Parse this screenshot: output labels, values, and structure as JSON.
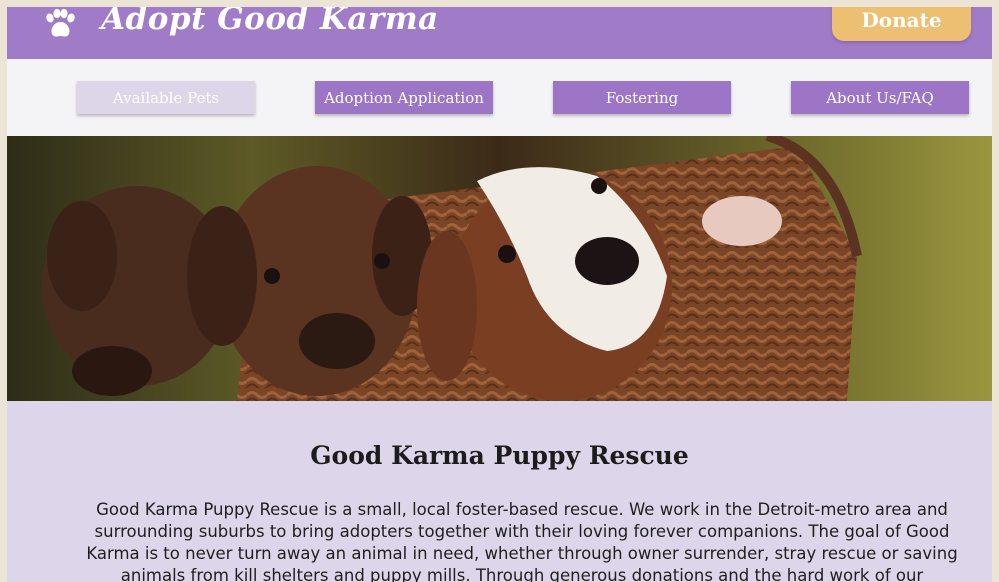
{
  "header": {
    "brand": "Adopt Good Karma",
    "logo_icon": "paw-icon",
    "donate_label": "Donate",
    "colors": {
      "header_bg": "#a07bc8",
      "donate_bg": "#ecbf72"
    }
  },
  "nav": {
    "items": [
      {
        "label": "Available Pets",
        "active": true
      },
      {
        "label": "Adoption Application",
        "active": false
      },
      {
        "label": "Fostering",
        "active": false
      },
      {
        "label": "About Us/FAQ",
        "active": false
      }
    ]
  },
  "hero": {
    "icon": "puppies-in-basket-photo"
  },
  "main": {
    "title": "Good Karma Puppy Rescue",
    "paragraph": "Good Karma Puppy Rescue is a small, local foster-based rescue. We work in the Detroit-metro area and surrounding suburbs to bring adopters together with their loving forever companions. The goal of Good Karma is to never turn away an animal in need, whether through owner surrender, stray rescue or saving animals from kill shelters and puppy mills. Through generous donations and the hard work of our volunteers"
  }
}
